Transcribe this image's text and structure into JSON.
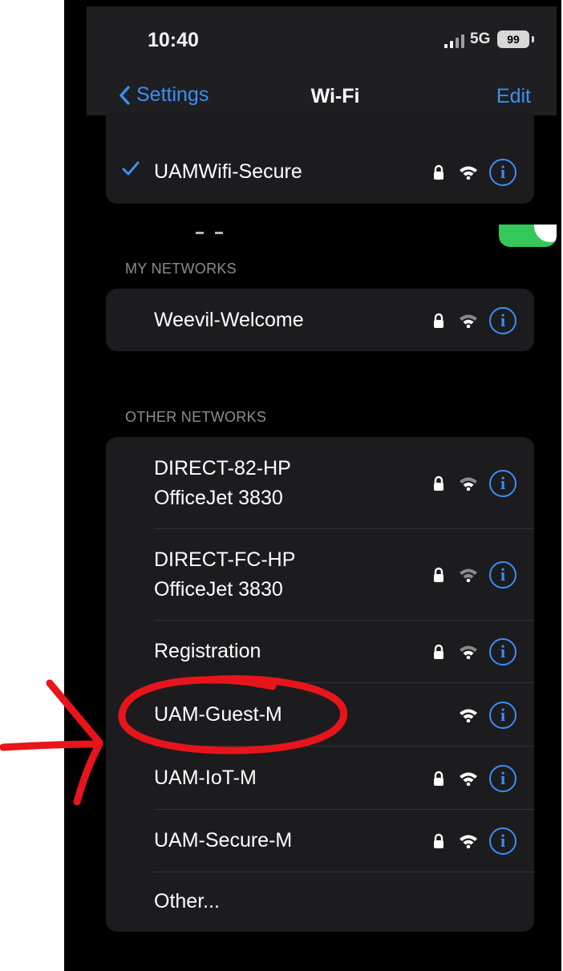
{
  "status_bar": {
    "time": "10:40",
    "network_type": "5G",
    "battery": "99"
  },
  "nav": {
    "back_label": "Settings",
    "title": "Wi-Fi",
    "edit_label": "Edit"
  },
  "wifi_toggle_on": true,
  "current_network": {
    "name": "UAMWifi-Secure",
    "connected": true,
    "secured": true
  },
  "my_networks": {
    "header": "MY NETWORKS",
    "items": [
      {
        "name": "Weevil-Welcome",
        "secured": true
      }
    ]
  },
  "other_networks": {
    "header": "OTHER NETWORKS",
    "items": [
      {
        "line1": "DIRECT-82-HP",
        "line2": "OfficeJet 3830",
        "secured": true
      },
      {
        "line1": "DIRECT-FC-HP",
        "line2": "OfficeJet 3830",
        "secured": true
      },
      {
        "name": "Registration",
        "secured": true
      },
      {
        "name": "UAM-Guest-M",
        "secured": false
      },
      {
        "name": "UAM-IoT-M",
        "secured": true
      },
      {
        "name": "UAM-Secure-M",
        "secured": true
      }
    ],
    "other_label": "Other..."
  },
  "annotation": {
    "color": "#e8141c",
    "circled_network": "UAM-Guest-M"
  },
  "colors": {
    "accent": "#3a8ff7",
    "toggle_on": "#34c759",
    "background": "#000000",
    "group_background": "#1c1c1e"
  }
}
